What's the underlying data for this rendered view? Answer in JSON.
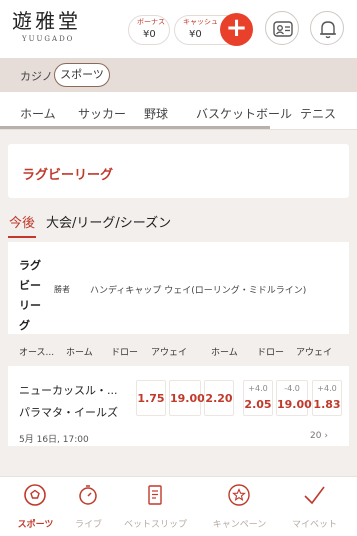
{
  "header": {
    "logo_main": "遊雅堂",
    "logo_sub": "YUUGADO",
    "bonus_label": "ボーナス",
    "bonus_value": "¥0",
    "cash_label": "キャッシュ",
    "cash_value": "¥0",
    "add_icon": "plus-icon",
    "profile_icon": "profile-icon",
    "bell_icon": "bell-icon"
  },
  "category": {
    "casino": "カジノ",
    "sports": "スポーツ"
  },
  "sport_tabs": [
    "ホーム",
    "サッカー",
    "野球",
    "バスケットボール",
    "テニス"
  ],
  "league": {
    "title": "ラグビーリーグ"
  },
  "period_tabs": {
    "active": "今後",
    "other": "大会/リーグ/シーズン"
  },
  "market": {
    "sport_lines": [
      "ラグ",
      "ビー",
      "リー",
      "グ"
    ],
    "win_label": "勝者",
    "handicap_label": "ハンディキャップ ウェイ(ローリング・ミドルライン)",
    "columns": [
      "オース...",
      "ホーム",
      "ドロー",
      "アウェイ",
      "ホーム",
      "ドロー",
      "アウェイ"
    ],
    "match": {
      "home": "ニューカッスル・...",
      "away": "パラマタ・イールズ",
      "win_odds": [
        "1.75",
        "19.00",
        "2.20"
      ],
      "handicap_lines": [
        "+4.0",
        "-4.0",
        "+4.0"
      ],
      "handicap_odds": [
        "2.05",
        "19.00",
        "1.83"
      ],
      "date": "5月 16日, 17:00",
      "more": "20"
    }
  },
  "bottom_nav": [
    {
      "label": "スポーツ",
      "icon": "sports-ball-icon",
      "active": true
    },
    {
      "label": "ライブ",
      "icon": "stopwatch-icon",
      "active": false
    },
    {
      "label": "ベットスリップ",
      "icon": "betslip-icon",
      "active": false
    },
    {
      "label": "キャンペーン",
      "icon": "campaign-star-icon",
      "active": false
    },
    {
      "label": "マイベット",
      "icon": "checkmark-icon",
      "active": false
    }
  ],
  "colors": {
    "accent": "#c0392b",
    "add_button": "#e8402a",
    "category_bg": "#e6ddd9"
  }
}
